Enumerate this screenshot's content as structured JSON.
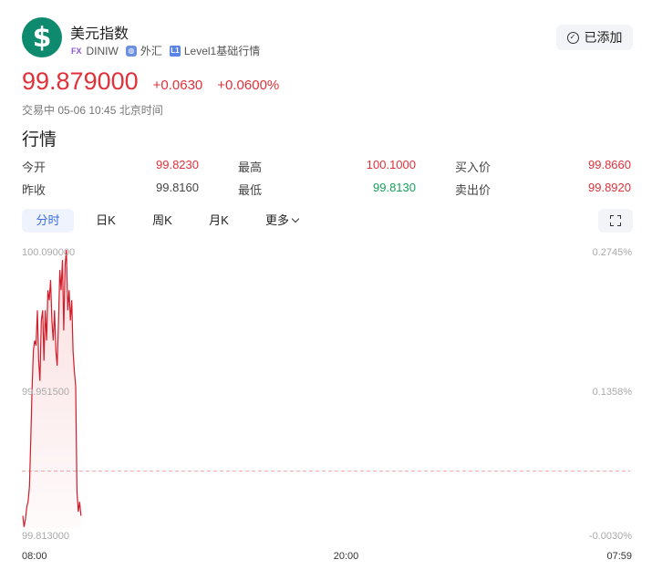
{
  "header": {
    "logo_glyph": "$",
    "name": "美元指数",
    "tags": [
      {
        "icon": "FX",
        "label": "DINIW"
      },
      {
        "icon": "globe-icon",
        "label": "外汇"
      },
      {
        "icon": "L1",
        "label": "Level1基础行情"
      }
    ],
    "add_label": "已添加"
  },
  "quote": {
    "price": "99.879000",
    "change": "+0.0630",
    "change_pct": "+0.0600%",
    "status": "交易中 05-06 10:45 北京时间"
  },
  "section_title": "行情",
  "stats": [
    [
      {
        "label": "今开",
        "value": "99.8230"
      },
      {
        "label": "最高",
        "value": "100.1000"
      },
      {
        "label": "买入价",
        "value": "99.8660"
      }
    ],
    [
      {
        "label": "昨收",
        "value": "99.8160"
      },
      {
        "label": "最低",
        "value": "99.8130"
      },
      {
        "label": "卖出价",
        "value": "99.8920"
      }
    ]
  ],
  "tabs": [
    "分时",
    "日K",
    "周K",
    "月K",
    "更多"
  ],
  "colors": {
    "up": "#e0313a",
    "down": "#16a05a",
    "accent": "#3d6fe0"
  },
  "chart_data": {
    "type": "line",
    "y_left_ticks": [
      "100.090000",
      "99.951500",
      "99.813000"
    ],
    "y_right_ticks": [
      "0.2745%",
      "0.1358%",
      "-0.0030%"
    ],
    "x_ticks": [
      "08:00",
      "20:00",
      "07:59"
    ],
    "ylim": [
      99.813,
      100.09
    ],
    "prev_close": 99.816,
    "x_total_minutes": 1440,
    "series": [
      {
        "values": [
          99.826,
          99.815,
          99.823,
          99.835,
          99.84,
          99.855,
          99.9,
          99.95,
          99.99,
          100.0,
          99.995,
          100.03,
          99.98,
          99.96,
          100.02,
          100.03,
          99.98,
          100.03,
          100.0,
          100.05,
          100.04,
          100.06,
          100.02,
          100.0,
          100.03,
          99.99,
          99.975,
          100.02,
          100.07,
          100.05,
          100.08,
          100.01,
          100.075,
          100.09,
          100.03,
          100.05,
          100.02,
          100.04,
          99.99,
          99.97,
          99.955,
          99.85,
          99.83,
          99.84,
          99.826
        ]
      }
    ]
  }
}
